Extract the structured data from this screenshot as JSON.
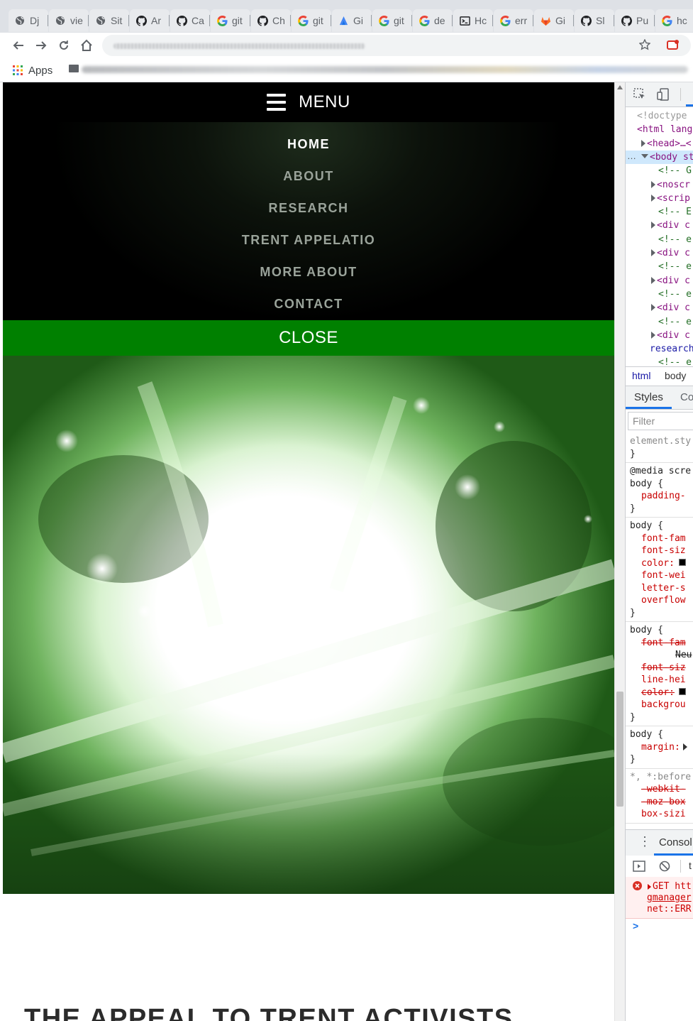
{
  "browser": {
    "tabs": [
      {
        "icon": "globe-icon",
        "title": "Dj"
      },
      {
        "icon": "globe-icon",
        "title": "vie"
      },
      {
        "icon": "globe-icon",
        "title": "Sit"
      },
      {
        "icon": "github-icon",
        "title": "Ar"
      },
      {
        "icon": "github-icon",
        "title": "Ca"
      },
      {
        "icon": "google-icon",
        "title": "git"
      },
      {
        "icon": "github-icon",
        "title": "Ch"
      },
      {
        "icon": "google-icon",
        "title": "git"
      },
      {
        "icon": "gcp-icon",
        "title": "Gi"
      },
      {
        "icon": "google-icon",
        "title": "git"
      },
      {
        "icon": "google-icon",
        "title": "de"
      },
      {
        "icon": "terminal-icon",
        "title": "Hc"
      },
      {
        "icon": "google-icon",
        "title": "err"
      },
      {
        "icon": "gitlab-icon",
        "title": "Gi"
      },
      {
        "icon": "github-icon",
        "title": "Sl"
      },
      {
        "icon": "github-icon",
        "title": "Pu"
      },
      {
        "icon": "google-icon",
        "title": "hc"
      }
    ],
    "bookmarks": {
      "apps_label": "Apps"
    }
  },
  "site": {
    "menu_label": "MENU",
    "nav_items": [
      {
        "label": "HOME",
        "active": true
      },
      {
        "label": "ABOUT",
        "active": false
      },
      {
        "label": "RESEARCH",
        "active": false
      },
      {
        "label": "TRENT APPELATIO",
        "active": false
      },
      {
        "label": "MORE ABOUT",
        "active": false
      },
      {
        "label": "CONTACT",
        "active": false
      }
    ],
    "close_label": "CLOSE",
    "headline": "THE APPEAL TO TRENT ACTIVISTS",
    "colors": {
      "accent": "#008000",
      "menu_bg": "#000000"
    }
  },
  "devtools": {
    "elements": [
      {
        "text": "<!doctype"
      },
      {
        "text": "<html lang"
      },
      {
        "text": "<head>…<"
      },
      {
        "text": "<body st"
      },
      {
        "text": "<!-- G"
      },
      {
        "text": "<noscr"
      },
      {
        "text": "<scrip"
      },
      {
        "text": "<!-- E"
      },
      {
        "text": "<div c"
      },
      {
        "text": "<!-- e"
      },
      {
        "text": "<div c"
      },
      {
        "text": "<!-- e"
      },
      {
        "text": "<div c"
      },
      {
        "text": "<!-- e"
      },
      {
        "text": "<div c"
      },
      {
        "text": "<!-- e"
      },
      {
        "text": "<div c"
      },
      {
        "text": "research"
      },
      {
        "text": "<!-- e"
      }
    ],
    "breadcrumbs": [
      "html",
      "body"
    ],
    "styles_tab": "Styles",
    "computed_tab": "Co",
    "filter_placeholder": "Filter",
    "rules": [
      {
        "selector": "element.sty",
        "closing": "}",
        "props": []
      },
      {
        "selector": "@media scre",
        "sub": "body {",
        "closing": "}",
        "props": [
          "padding-"
        ]
      },
      {
        "selector": "body {",
        "closing": "}",
        "props": [
          "font-fam",
          "font-siz",
          "color:",
          "font-wei",
          "letter-s",
          "overflow"
        ]
      },
      {
        "selector": "body {",
        "closing": "}",
        "props": [
          "font-fam",
          "Neu",
          "font-siz",
          "line-hei",
          "color:",
          "backgrou"
        ]
      },
      {
        "selector": "body {",
        "closing": "}",
        "props": [
          "margin:"
        ]
      },
      {
        "selector": "*, *:before",
        "closing": "",
        "props": [
          "-webkit-",
          "-moz-box",
          "box-sizi"
        ]
      }
    ],
    "console_tab": "Consol",
    "console_filter": "t",
    "error_lines": [
      "GET htt",
      "gmanager",
      "net::ERR"
    ],
    "prompt": ">"
  }
}
